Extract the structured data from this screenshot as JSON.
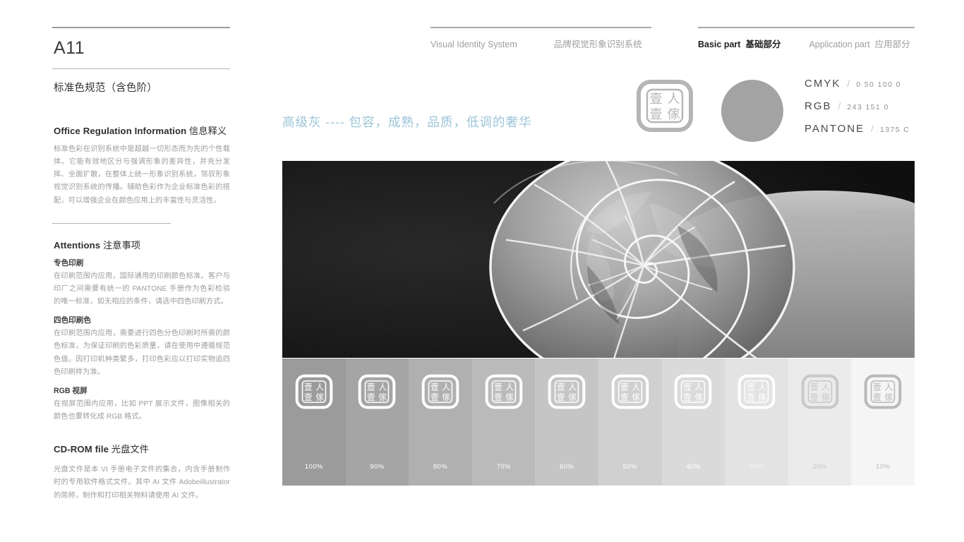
{
  "page_code": "A11",
  "section_title": "标准色规范（含色阶）",
  "nav": {
    "left": {
      "en": "Visual Identity System",
      "cn": "品牌视觉形象识别系统"
    },
    "right": [
      {
        "en": "Basic part",
        "cn": "基础部分",
        "active": true
      },
      {
        "en": "Application part",
        "cn": "应用部分",
        "active": false
      }
    ]
  },
  "tagline": "高级灰 ---- 包容，成熟，品质，低调的奢华",
  "logo": {
    "chars": [
      "壹",
      "人",
      "壹",
      "傢"
    ],
    "name": "brand-logo"
  },
  "color": {
    "chip_hex": "#a3a3a3",
    "specs": [
      {
        "label": "CMYK",
        "value": "0  50  100  0"
      },
      {
        "label": "RGB",
        "value": "243 151 0"
      },
      {
        "label": "PANTONE",
        "value": "1375 C"
      }
    ]
  },
  "info": {
    "head_en": "Office Regulation Information",
    "head_cn": "信息释义",
    "body": "标准色彩在识别系统中是超越一切形态而为先的个性载体。它能有效地区分与强调形象的差异性，并充分发挥、全面扩散，在整体上统一形象识别系统，驾驭形象视觉识别系统的传播。辅助色彩作为企业标准色彩的搭配，可以增强企业在颜色应用上的丰富性与灵活性。"
  },
  "attentions": {
    "head_en": "Attentions",
    "head_cn": "注意事项",
    "items": [
      {
        "title": "专色印刷",
        "body": "在印刷范围内应用，国际通用的印刷颜色标准。客户与印厂之间需要有统一的 PANTONE 手册作为色彩检验的唯一标准，如无相应的条件，请选中四色印刷方式。"
      },
      {
        "title": "四色印刷色",
        "body": "在印刷范围内应用，需要进行四色分色印刷时所需的颜色标准，为保证印刷的色彩质量，请在使用中遵循规范色值。因打印机种类繁多，打印色彩应以打印实物追四色印刷样为准。"
      },
      {
        "title": "RGB 视屏",
        "body": "在视屏范围内应用，比如 PPT 展示文件，图像相关的颜色也要转化成 RGB 格式。"
      }
    ]
  },
  "cdrom": {
    "head_en": "CD-ROM file",
    "head_cn": "光盘文件",
    "body": "光盘文件是本 VI 手册电子文件的集合，内含手册制作时的专用软件格式文件。其中 AI 文件 Adobeillustrator 的简称，制作和打印相关物料请使用 AI 文件。"
  },
  "swatches": [
    {
      "pct": "100%",
      "bg": "#9b9b9b",
      "logo_color": "#ffffff",
      "text_color": "#ffffff"
    },
    {
      "pct": "90%",
      "bg": "#a5a5a5",
      "logo_color": "#ffffff",
      "text_color": "#ffffff"
    },
    {
      "pct": "80%",
      "bg": "#b0b0b0",
      "logo_color": "#ffffff",
      "text_color": "#ffffff"
    },
    {
      "pct": "70%",
      "bg": "#bababa",
      "logo_color": "#ffffff",
      "text_color": "#ffffff"
    },
    {
      "pct": "60%",
      "bg": "#c5c5c5",
      "logo_color": "#ffffff",
      "text_color": "#ffffff"
    },
    {
      "pct": "50%",
      "bg": "#d0d0d0",
      "logo_color": "#ffffff",
      "text_color": "#ffffff"
    },
    {
      "pct": "40%",
      "bg": "#dadada",
      "logo_color": "#ffffff",
      "text_color": "#ffffff"
    },
    {
      "pct": "30%",
      "bg": "#e3e3e3",
      "logo_color": "#ffffff",
      "text_color": "#f3f3f3"
    },
    {
      "pct": "20%",
      "bg": "#ebebeb",
      "logo_color": "#c8c8c8",
      "text_color": "#c9c9c9"
    },
    {
      "pct": "10%",
      "bg": "#f5f5f5",
      "logo_color": "#b9b9b9",
      "text_color": "#b9b9b9"
    }
  ]
}
